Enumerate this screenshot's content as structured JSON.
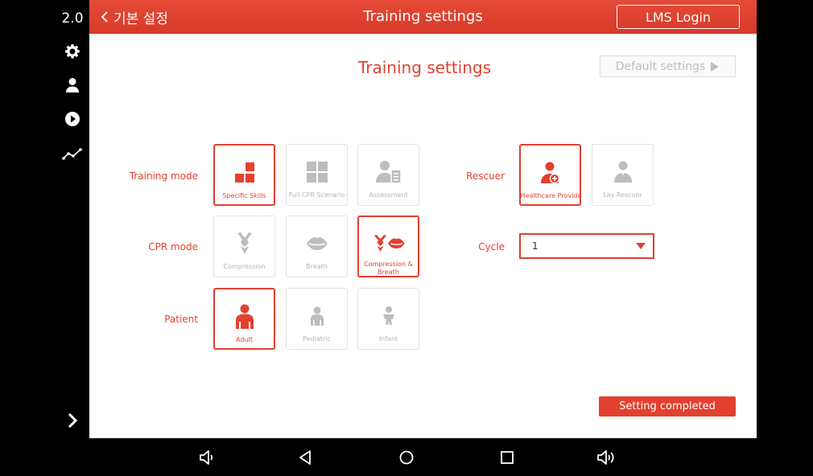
{
  "rail": {
    "version": "2.0",
    "icons": [
      "gear-icon",
      "person-icon",
      "play-icon",
      "chart-line-icon",
      "chevron-right-icon"
    ]
  },
  "header": {
    "back_label": "기본 설정",
    "title": "Training settings",
    "lms_label": "LMS Login"
  },
  "main": {
    "title": "Training settings",
    "default_label": "Default settings",
    "rows": {
      "training_mode": {
        "label": "Training mode",
        "options": [
          "Specific Skills",
          "Full CPR Scenario",
          "Assessment"
        ],
        "selected": "Specific Skills"
      },
      "cpr_mode": {
        "label": "CPR mode",
        "options": [
          "Compression",
          "Breath",
          "Compression & Breath"
        ],
        "selected": "Compression & Breath"
      },
      "patient": {
        "label": "Patient",
        "options": [
          "Adult",
          "Pediatric",
          "Infant"
        ],
        "selected": "Adult"
      },
      "rescuer": {
        "label": "Rescuer",
        "options": [
          "Healthcare Provider",
          "Lay Rescuer"
        ],
        "selected": "Healthcare Provider"
      },
      "cycle": {
        "label": "Cycle",
        "value": "1"
      }
    },
    "complete_label": "Setting completed"
  },
  "colors": {
    "accent": "#e3402f",
    "inactive": "#b5b5b5",
    "header": "#e2402f"
  }
}
